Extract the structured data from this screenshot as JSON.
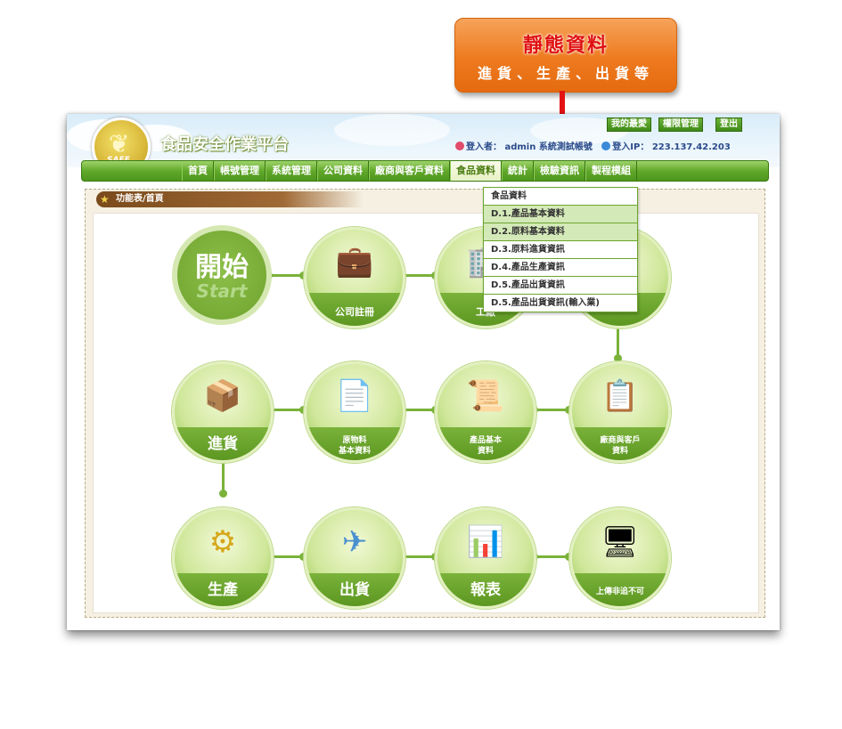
{
  "callout": {
    "title": "靜態資料",
    "subtitle": "進貨、生產、出貨等",
    "color": "#ee7a1f",
    "arrow_color": "#e41313"
  },
  "header": {
    "title": "食品安全作業平台",
    "logo_text": "SAFE",
    "buttons": [
      "我的最愛",
      "權限管理",
      "登出"
    ],
    "login_label": "登入者：",
    "login_user": "admin 系統測試帳號",
    "ip_label": "登入IP：",
    "ip": "223.137.42.203"
  },
  "nav": {
    "items": [
      "首頁",
      "帳號管理",
      "系統管理",
      "公司資料",
      "廠商與客戶資料",
      "食品資料",
      "統計",
      "檢驗資訊",
      "製程模組"
    ],
    "selected_index": 5
  },
  "breadcrumb": "功能表/首頁",
  "dropdown": {
    "items": [
      "食品資料",
      "D.1.產品基本資料",
      "D.2.原料基本資料",
      "D.3.原料進貨資訊",
      "D.4.產品生產資訊",
      "D.5.產品出貨資訊",
      "D.5.產品出貨資訊(輸入業)"
    ],
    "highlighted": [
      1,
      2
    ]
  },
  "flow": {
    "start": {
      "zh": "開始",
      "en": "Start"
    },
    "tiles": [
      {
        "label": "公司註冊",
        "icon": "briefcase-icon",
        "glyph": "💼"
      },
      {
        "label": "工廠",
        "icon": "factory-icon",
        "glyph": "🏢"
      },
      {
        "label": "",
        "icon": "product-icon",
        "glyph": "📦"
      },
      {
        "label": "進貨",
        "icon": "boxes-icon",
        "glyph": "📦"
      },
      {
        "label": "原物料\n基本資料",
        "label1": "原物料",
        "label2": "基本資料",
        "icon": "document-icon",
        "glyph": "📄"
      },
      {
        "label": "產品基本\n資料",
        "label1": "產品基本",
        "label2": "資料",
        "icon": "certificate-icon",
        "glyph": "📜"
      },
      {
        "label": "廠商與客戶\n資料",
        "label1": "廠商與客戶",
        "label2": "資料",
        "icon": "vendor-icon",
        "glyph": "📋"
      },
      {
        "label": "生產",
        "icon": "gears-icon",
        "glyph": "⚙"
      },
      {
        "label": "出貨",
        "icon": "shipping-icon",
        "glyph": "✈"
      },
      {
        "label": "報表",
        "icon": "chart-icon",
        "glyph": "📊"
      },
      {
        "label": "上傳非追不可",
        "icon": "ie-monitor-icon",
        "glyph": "🖥"
      }
    ]
  },
  "colors": {
    "nav_green": "#61a92b",
    "band_green": "#6ea32c",
    "title_red": "#e01010"
  }
}
